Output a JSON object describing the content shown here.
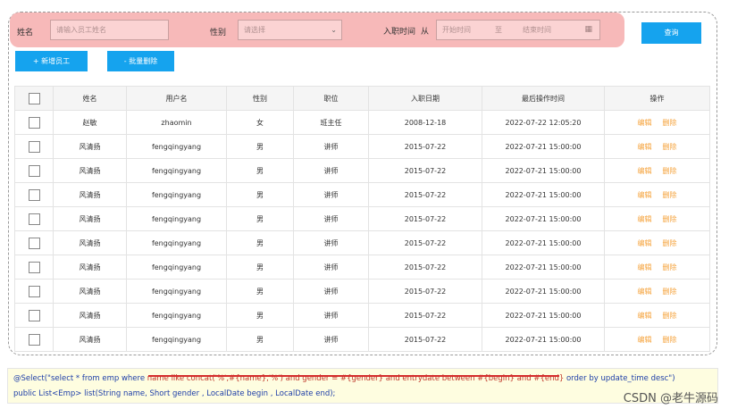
{
  "search": {
    "name_label": "姓名",
    "name_placeholder": "请输入员工姓名",
    "gender_label": "性别",
    "gender_placeholder": "请选择",
    "date_label": "入职时间",
    "date_from": "从",
    "date_start_placeholder": "开始时间",
    "date_sep": "至",
    "date_end_placeholder": "结束时间",
    "query_button": "查询"
  },
  "toolbar": {
    "add_button": "+ 新增员工",
    "batch_delete_button": "- 批量删除"
  },
  "table": {
    "columns": [
      "姓名",
      "用户名",
      "性别",
      "职位",
      "入职日期",
      "最后操作时间",
      "操作"
    ],
    "edit_label": "编辑",
    "delete_label": "删除",
    "rows": [
      {
        "name": "赵敏",
        "username": "zhaomin",
        "gender": "女",
        "job": "班主任",
        "entry": "2008-12-18",
        "updated": "2022-07-22 12:05:20"
      },
      {
        "name": "风清扬",
        "username": "fengqingyang",
        "gender": "男",
        "job": "讲师",
        "entry": "2015-07-22",
        "updated": "2022-07-21 15:00:00"
      },
      {
        "name": "风清扬",
        "username": "fengqingyang",
        "gender": "男",
        "job": "讲师",
        "entry": "2015-07-22",
        "updated": "2022-07-21 15:00:00"
      },
      {
        "name": "风清扬",
        "username": "fengqingyang",
        "gender": "男",
        "job": "讲师",
        "entry": "2015-07-22",
        "updated": "2022-07-21 15:00:00"
      },
      {
        "name": "风清扬",
        "username": "fengqingyang",
        "gender": "男",
        "job": "讲师",
        "entry": "2015-07-22",
        "updated": "2022-07-21 15:00:00"
      },
      {
        "name": "风清扬",
        "username": "fengqingyang",
        "gender": "男",
        "job": "讲师",
        "entry": "2015-07-22",
        "updated": "2022-07-21 15:00:00"
      },
      {
        "name": "风清扬",
        "username": "fengqingyang",
        "gender": "男",
        "job": "讲师",
        "entry": "2015-07-22",
        "updated": "2022-07-21 15:00:00"
      },
      {
        "name": "风清扬",
        "username": "fengqingyang",
        "gender": "男",
        "job": "讲师",
        "entry": "2015-07-22",
        "updated": "2022-07-21 15:00:00"
      },
      {
        "name": "风清扬",
        "username": "fengqingyang",
        "gender": "男",
        "job": "讲师",
        "entry": "2015-07-22",
        "updated": "2022-07-21 15:00:00"
      },
      {
        "name": "风清扬",
        "username": "fengqingyang",
        "gender": "男",
        "job": "讲师",
        "entry": "2015-07-22",
        "updated": "2022-07-21 15:00:00"
      }
    ]
  },
  "code": {
    "line1_a": "@Select(\"select * from emp where ",
    "line1_b": "name like  concat('%',#{name},'%') and gender = #{gender} and entrydate between #{begin} and #{end}",
    "line1_c": " order by update_time desc\")",
    "line2": "public List<Emp> list(String name, Short gender , LocalDate begin , LocalDate end);"
  },
  "watermark": "CSDN @老牛源码",
  "colors": {
    "accent": "#15a3ee",
    "search_bg": "#f7b9b9",
    "action": "#f5a23a"
  }
}
